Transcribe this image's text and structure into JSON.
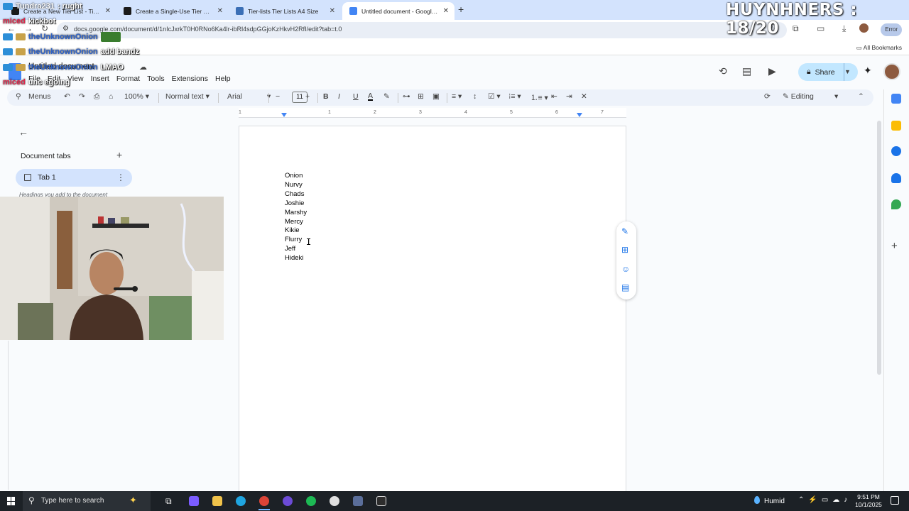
{
  "browser": {
    "tabs": [
      {
        "title": "Create a New Tier List - TierMaker",
        "favicon_color": "#1a1a1a",
        "active": false
      },
      {
        "title": "Create a Single-Use Tier List (P...",
        "favicon_color": "#1a1a1a",
        "active": false
      },
      {
        "title": "Tier-lists Tier Lists A4 Size",
        "favicon_color": "#3b6fb6",
        "active": false
      },
      {
        "title": "Untitled document - Google Do...",
        "favicon_color": "#4285f4",
        "active": true
      }
    ],
    "new_tab_glyph": "+",
    "close_glyph": "✕",
    "url": "docs.google.com/document/d/1nIcJxrkT0H0RNo6Ka4lr-ibRl4sdpGGjoKzHkvH2RfI/edit?tab=t.0",
    "error_label": "Error",
    "bookmarks_label": "All Bookmarks"
  },
  "docs": {
    "title": "Untitled document",
    "menu": [
      "File",
      "Edit",
      "View",
      "Insert",
      "Format",
      "Tools",
      "Extensions",
      "Help"
    ],
    "share_label": "Share",
    "toolbar": {
      "menus_label": "Menus",
      "zoom": "100%",
      "style": "Normal text",
      "font": "Arial",
      "font_size": "11",
      "mode": "Editing"
    },
    "ruler_numbers": [
      "1",
      "1",
      "2",
      "3",
      "4",
      "5",
      "6",
      "7"
    ],
    "outline": {
      "tabs_title": "Document tabs",
      "tab_label": "Tab 1",
      "hint": "Headings you add to the document"
    },
    "content_lines": [
      "Onion",
      "Nurvy",
      "Chads",
      "Joshie",
      "Marshy",
      "Mercy",
      "Kikie",
      "Flurry",
      "Jeff",
      "Hideki"
    ]
  },
  "overlay": {
    "score_title": "HUYNHNERS : 18/20",
    "chat": [
      {
        "user": "Tundra231",
        "msg": ": rught",
        "color": "#ffffff"
      },
      {
        "user": "miced",
        "msg": "kickbot",
        "color": "#e0264b"
      },
      {
        "user": "theUnknownOnion",
        "msg": "",
        "color": "#2f63c9"
      },
      {
        "user": "theUnknownOnion",
        "msg": "add bandz",
        "color": "#2f63c9"
      },
      {
        "user": "theUnknownOnion",
        "msg": "LMAO",
        "color": "#2f63c9"
      },
      {
        "user": "miced",
        "msg": "unc egoing",
        "color": "#e0264b"
      }
    ]
  },
  "taskbar": {
    "search_placeholder": "Type here to search",
    "weather": "Humid",
    "time": "9:51 PM",
    "date": "10/1/2025"
  }
}
